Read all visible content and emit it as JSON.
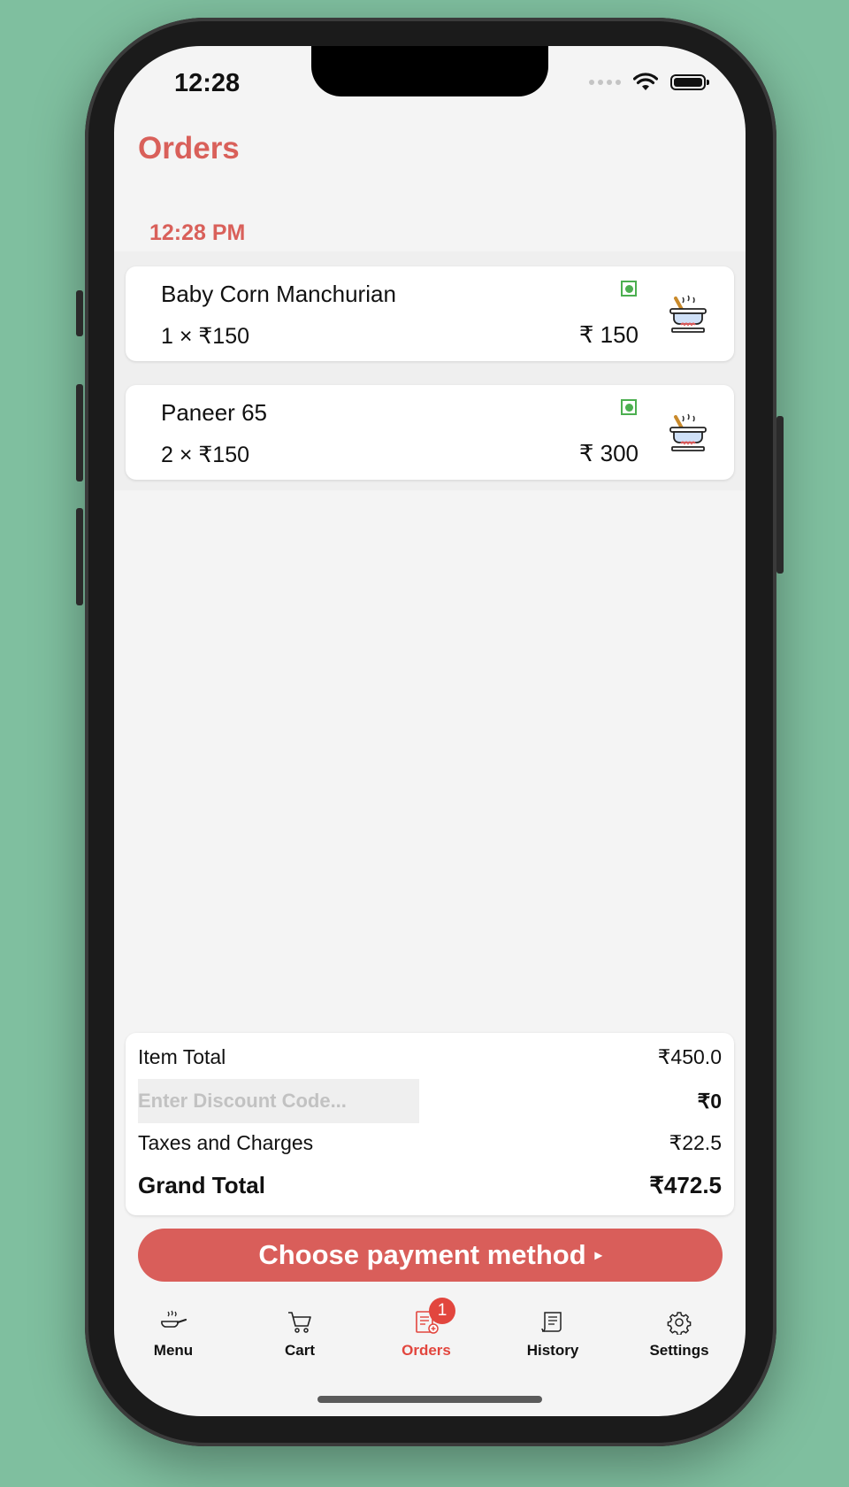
{
  "status_bar": {
    "time": "12:28"
  },
  "header": {
    "title": "Orders"
  },
  "order_group": {
    "time": "12:28 PM"
  },
  "orders": [
    {
      "name": "Baby Corn Manchurian",
      "quantity_line": "1  ×  ₹150",
      "amount": "₹ 150"
    },
    {
      "name": "Paneer 65",
      "quantity_line": "2  ×  ₹150",
      "amount": "₹ 300"
    }
  ],
  "summary": {
    "item_total_label": "Item Total",
    "item_total_value": "₹450.0",
    "discount_placeholder": "Enter Discount Code...",
    "discount_value": "₹0",
    "taxes_label": "Taxes and Charges",
    "taxes_value": "₹22.5",
    "grand_total_label": "Grand Total",
    "grand_total_value": "₹472.5"
  },
  "payment_button": {
    "label": "Choose payment method",
    "arrow": "▸"
  },
  "tabs": [
    {
      "label": "Menu",
      "icon": "pan-icon"
    },
    {
      "label": "Cart",
      "icon": "cart-icon"
    },
    {
      "label": "Orders",
      "icon": "orders-icon",
      "badge": "1",
      "active": true
    },
    {
      "label": "History",
      "icon": "receipt-icon"
    },
    {
      "label": "Settings",
      "icon": "gear-icon"
    }
  ],
  "colors": {
    "accent": "#d9605a",
    "badge": "#e2463e",
    "veg": "#4caf50",
    "background": "#7fbf9f"
  }
}
